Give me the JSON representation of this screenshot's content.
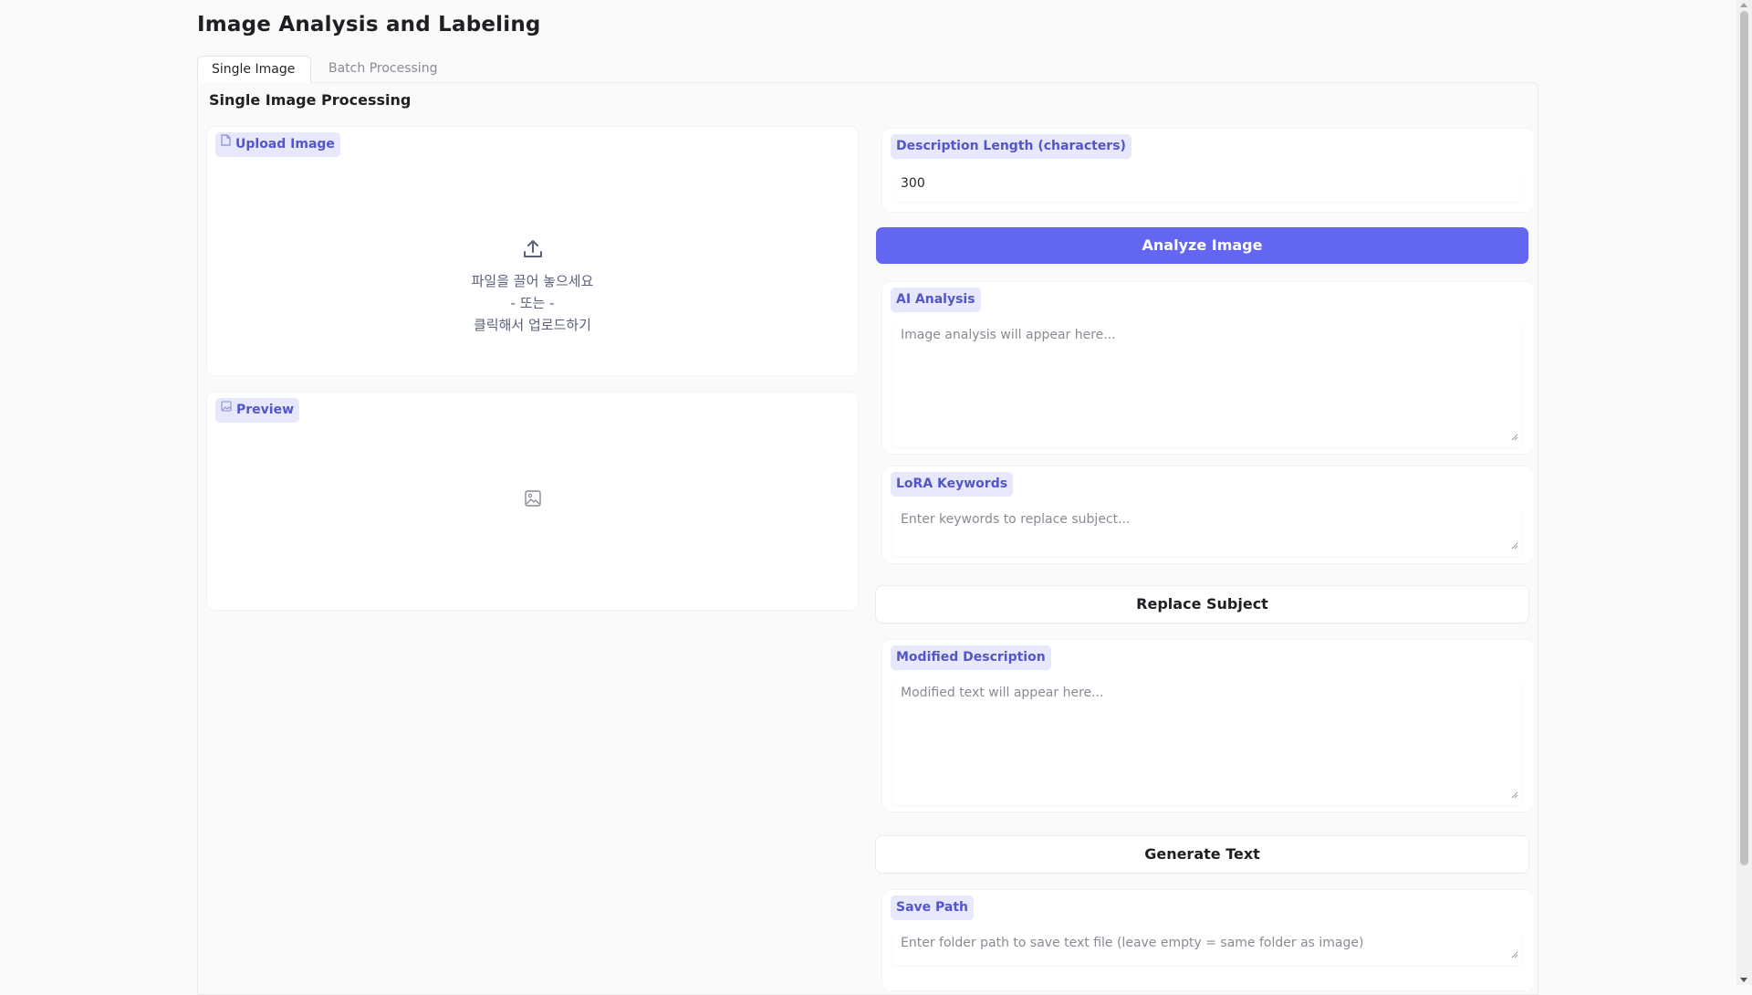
{
  "app": {
    "title": "Image Analysis and Labeling"
  },
  "tabs": [
    {
      "label": "Single Image",
      "active": true
    },
    {
      "label": "Batch Processing",
      "active": false
    }
  ],
  "single": {
    "section_title": "Single Image Processing",
    "upload": {
      "label": "Upload Image",
      "icon": "file-icon",
      "drop_line1": "파일을 끌어 놓으세요",
      "drop_line2": "- 또는 -",
      "drop_line3": "클릭해서 업로드하기"
    },
    "preview": {
      "label": "Preview",
      "icon": "image-icon"
    },
    "description_length": {
      "label": "Description Length (characters)",
      "value": "300"
    },
    "analyze_button": "Analyze Image",
    "ai_analysis": {
      "label": "AI Analysis",
      "placeholder": "Image analysis will appear here..."
    },
    "lora_keywords": {
      "label": "LoRA Keywords",
      "placeholder": "Enter keywords to replace subject..."
    },
    "replace_button": "Replace Subject",
    "modified_description": {
      "label": "Modified Description",
      "placeholder": "Modified text will appear here..."
    },
    "generate_button": "Generate Text",
    "save_path": {
      "label": "Save Path",
      "placeholder": "Enter folder path to save text file (leave empty = same folder as image)"
    }
  },
  "colors": {
    "accent": "#6366f1",
    "chip_bg": "#e7e8fb",
    "chip_text": "#5256c8"
  }
}
